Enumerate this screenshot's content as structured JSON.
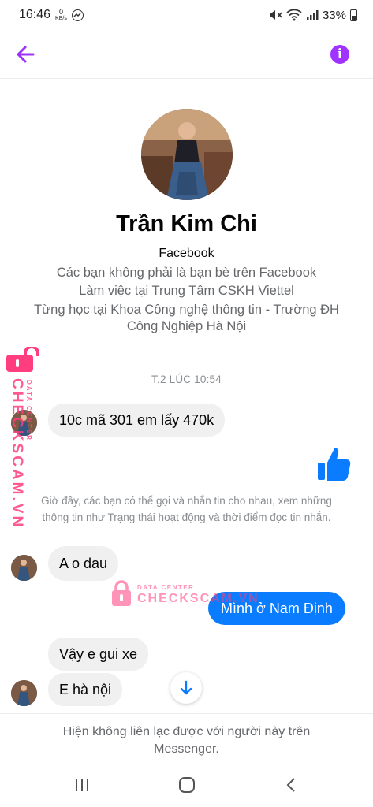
{
  "status_bar": {
    "time": "16:46",
    "data_rate_value": "0",
    "data_rate_unit": "KB/s",
    "battery": "33%",
    "icons": [
      "messenger-icon",
      "mute-icon",
      "wifi-icon",
      "signal-icon",
      "battery-icon"
    ]
  },
  "header": {
    "back_icon": "arrow-left-icon",
    "info_icon": "info-icon",
    "info_glyph": "i",
    "accent_color": "#a033ff"
  },
  "profile": {
    "name": "Trần Kim Chi",
    "platform": "Facebook",
    "friend_status": "Các bạn không phải là bạn bè trên Facebook",
    "work": "Làm việc tại Trung Tâm CSKH Viettel",
    "education_line1": "Từng học tại Khoa Công nghệ thông tin - Trường ĐH",
    "education_line2": "Công Nghiệp Hà Nội"
  },
  "conversation": {
    "timestamp": "T.2 LÚC 10:54",
    "messages": [
      {
        "from": "them",
        "text": "10c mã 301 em lấy 470k"
      },
      {
        "from": "me",
        "type": "like"
      },
      {
        "from": "them",
        "text": "A o dau"
      },
      {
        "from": "me",
        "text": "Mình ở Nam Định"
      },
      {
        "from": "them",
        "text": "Vậy e gui xe"
      },
      {
        "from": "them",
        "text": "E hà nội"
      }
    ],
    "system_note": "Giờ đây, các bạn có thể gọi và nhắn tin cho nhau, xem những thông tin như Trạng thái hoạt động và thời điểm đọc tin nhắn.",
    "outgoing_color": "#0a7cff",
    "incoming_color": "#f0f0f0"
  },
  "footer": {
    "notice_line1": "Hiện không liên lạc được với người này trên",
    "notice_line2": "Messenger."
  },
  "watermark": {
    "label": "DATA CENTER",
    "brand": "CHECKSCAM.VN",
    "color": "#ff3d7f"
  }
}
